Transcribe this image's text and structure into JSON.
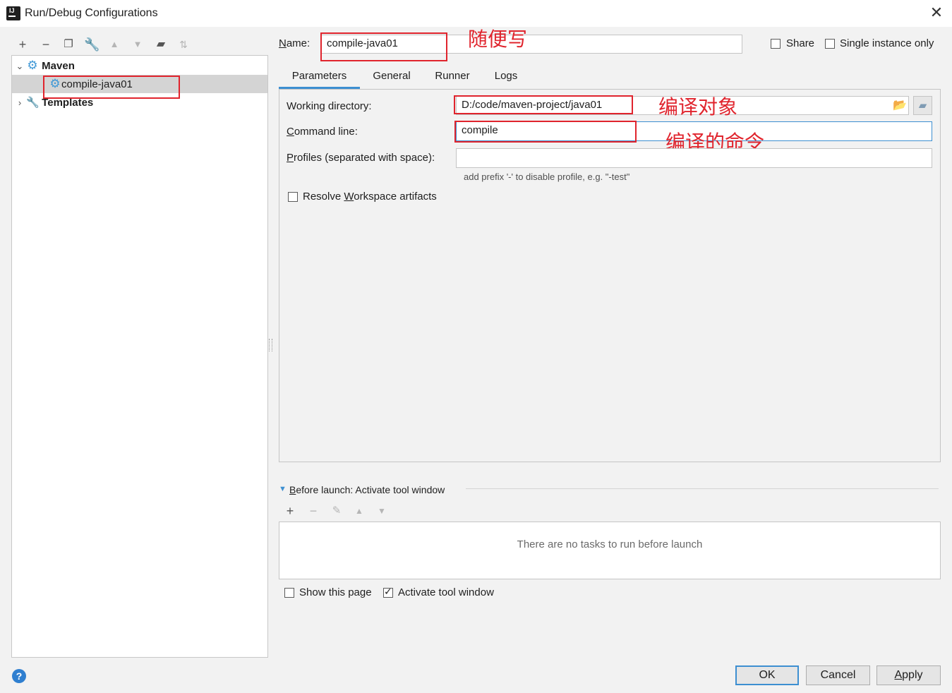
{
  "window": {
    "title": "Run/Debug Configurations",
    "close_glyph": "✕"
  },
  "left_toolbar": {
    "icons": [
      "add-icon",
      "remove-icon",
      "copy-icon",
      "wrench-icon",
      "move-up-icon",
      "move-down-icon",
      "new-folder-icon",
      "sort-icon"
    ]
  },
  "tree": {
    "maven_label": "Maven",
    "config_label": "compile-java01",
    "templates_label": "Templates"
  },
  "header": {
    "name_label": "Name:",
    "name_value": "compile-java01",
    "share_label": "Share",
    "single_instance_label": "Single instance only"
  },
  "tabs": [
    "Parameters",
    "General",
    "Runner",
    "Logs"
  ],
  "params": {
    "working_dir_label": "Working directory:",
    "working_dir_value": "D:/code/maven-project/java01",
    "command_line_label": "Command line:",
    "command_line_value": "compile",
    "profiles_label": "Profiles (separated with space):",
    "profiles_value": "",
    "profiles_hint": "add prefix '-' to disable profile, e.g. \"-test\"",
    "resolve_label": "Resolve Workspace artifacts"
  },
  "annotations": {
    "name_note": "随便写",
    "workdir_note": "编译对象",
    "command_note": "编译的命令"
  },
  "before_launch": {
    "title": "Before launch: Activate tool window",
    "empty_text": "There are no tasks to run before launch",
    "show_page_label": "Show this page",
    "activate_label": "Activate tool window"
  },
  "buttons": {
    "ok": "OK",
    "cancel": "Cancel",
    "apply": "Apply",
    "help": "?"
  },
  "colors": {
    "accent": "#3d8fd1",
    "annotation": "#e0242d",
    "maven_gear": "#3f98d6"
  }
}
